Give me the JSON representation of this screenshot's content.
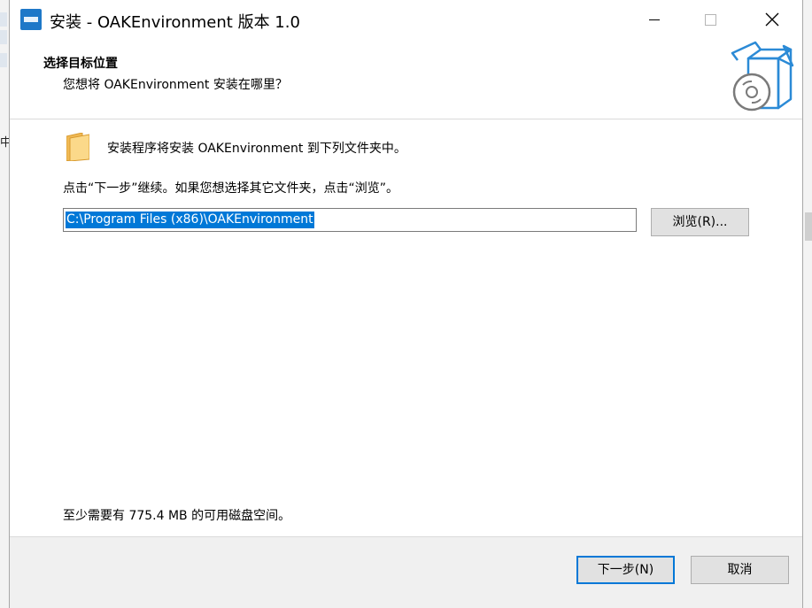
{
  "window": {
    "title": "安装 - OAKEnvironment 版本 1.0"
  },
  "page": {
    "heading": "选择目标位置",
    "subheading": "您想将 OAKEnvironment 安装在哪里？",
    "info_line": "安装程序将安装 OAKEnvironment 到下列文件夹中。",
    "instruction": "点击“下一步”继续。如果您想选择其它文件夹，点击“浏览”。",
    "install_path": "C:\\Program Files (x86)\\OAKEnvironment",
    "browse_label": "浏览(R)...",
    "space_note": "至少需要有 775.4 MB 的可用磁盘空间。"
  },
  "footer": {
    "next_label": "下一步(N)",
    "cancel_label": "取消"
  },
  "background": {
    "fragment_text": "中"
  },
  "icons": {
    "app": "app-icon",
    "wizard": "software-box-cd-icon",
    "folder": "folder-icon",
    "minimize": "minimize-icon",
    "maximize": "maximize-icon",
    "close": "close-icon"
  },
  "colors": {
    "selection": "#0078d7",
    "default_button_border": "#0078d7",
    "wizard_icon": "#2b8ad6",
    "folder": "#f0b955"
  }
}
